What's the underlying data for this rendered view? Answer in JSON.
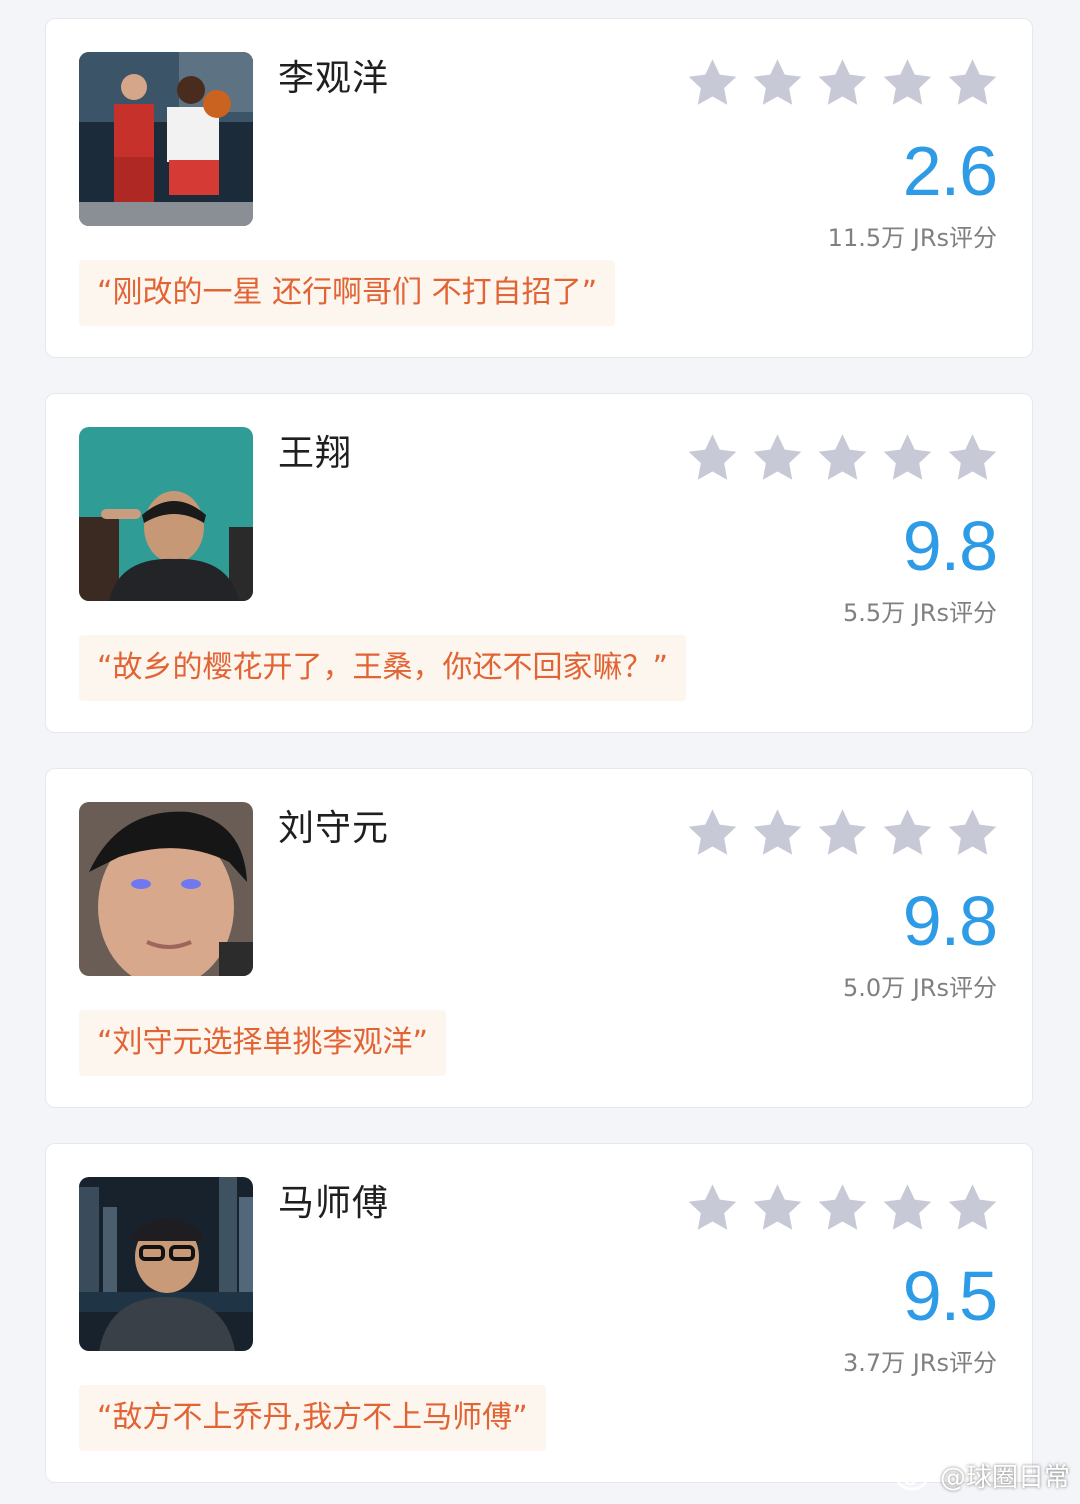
{
  "colors": {
    "background": "#f4f5f8",
    "card": "#ffffff",
    "score": "#2e9be6",
    "quote_text": "#e26334",
    "quote_bg": "#fdf6ee",
    "star": "#c8c9d6"
  },
  "icons": {
    "star": "star-icon",
    "watermark": "weibo-logo-icon"
  },
  "cards": [
    {
      "name": "李观洋",
      "stars_filled": 0,
      "score": "2.6",
      "rating_count": "11.5万 JRs评分",
      "quote": "“刚改的一星 还行啊哥们 不打自招了”"
    },
    {
      "name": "王翔",
      "stars_filled": 0,
      "score": "9.8",
      "rating_count": "5.5万 JRs评分",
      "quote": "“故乡的樱花开了，王桑，你还不回家嘛？”"
    },
    {
      "name": "刘守元",
      "stars_filled": 0,
      "score": "9.8",
      "rating_count": "5.0万 JRs评分",
      "quote": "“刘守元选择单挑李观洋”"
    },
    {
      "name": "马师傅",
      "stars_filled": 0,
      "score": "9.5",
      "rating_count": "3.7万 JRs评分",
      "quote": "“敌方不上乔丹,我方不上马师傅”"
    }
  ],
  "watermark": {
    "text": "@球圈日常"
  }
}
